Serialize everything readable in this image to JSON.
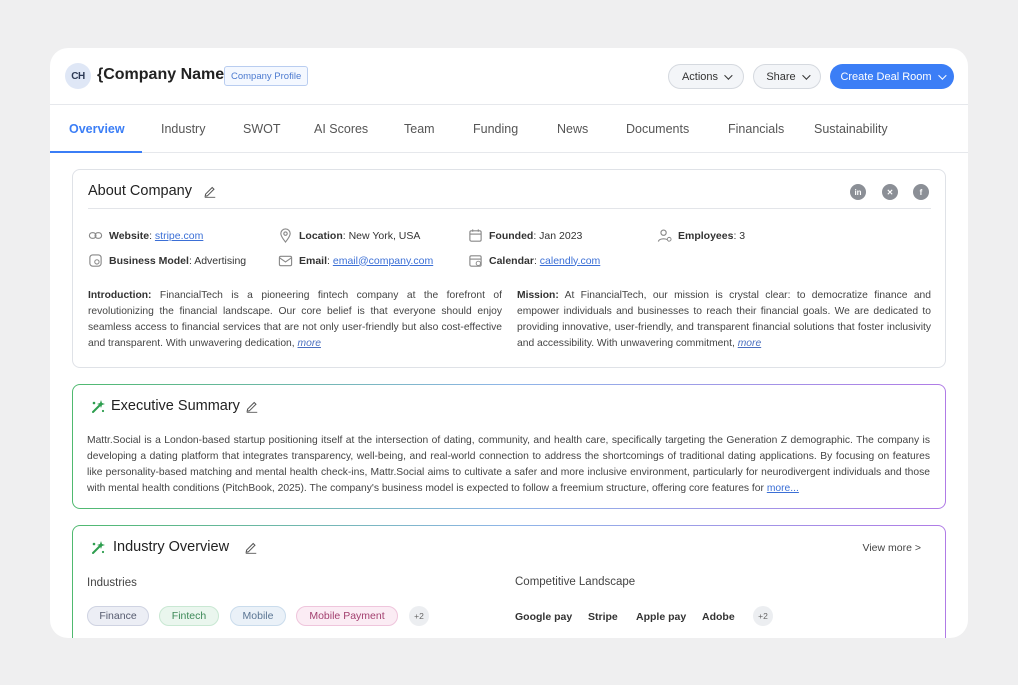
{
  "header": {
    "avatar_initials": "CH",
    "company_name": "{Company Name}",
    "badge": "Company Profile",
    "actions_label": "Actions",
    "share_label": "Share",
    "create_label": "Create Deal Room"
  },
  "tabs": [
    "Overview",
    "Industry",
    "SWOT",
    "AI Scores",
    "Team",
    "Funding",
    "News",
    "Documents",
    "Financials",
    "Sustainability"
  ],
  "about": {
    "title": "About Company",
    "website_label": "Website",
    "website_value": "stripe.com",
    "location_label": "Location",
    "location_value": "New York, USA",
    "founded_label": "Founded",
    "founded_value": "Jan 2023",
    "employees_label": "Employees",
    "employees_value": "3",
    "model_label": "Business Model",
    "model_value": "Advertising",
    "email_label": "Email",
    "email_value": "email@company.com",
    "calendar_label": "Calendar",
    "calendar_value": "calendly.com",
    "intro_label": "Introduction:",
    "intro_text": "FinancialTech is a pioneering fintech company at the forefront of revolutionizing the financial landscape. Our core belief is that everyone should enjoy seamless access to financial services that are not only user-friendly but also cost-effective and transparent. With unwavering dedication,",
    "mission_label": "Mission:",
    "mission_text": "At FinancialTech, our mission is crystal clear: to democratize finance and empower individuals and businesses to reach their financial goals. We are dedicated to providing innovative, user-friendly, and transparent financial solutions that foster inclusivity and accessibility. With unwavering commitment,",
    "more": "more"
  },
  "executive": {
    "title": "Executive Summary",
    "text": "Mattr.Social is a London-based startup positioning itself at the intersection of dating, community, and health care, specifically targeting the Generation Z demographic. The company is developing a dating platform that integrates transparency, well-being, and real-world connection to address the shortcomings of traditional dating applications. By focusing on features like personality-based matching and mental health check-ins, Mattr.Social aims to cultivate a safer and more inclusive environment, particularly for neurodivergent individuals and those with mental health conditions (PitchBook, 2025). The company's business model is expected to follow a freemium structure, offering core features for",
    "more": "more..."
  },
  "industry": {
    "title": "Industry Overview",
    "view_more": "View more >",
    "industries_heading": "Industries",
    "chips": [
      {
        "label": "Finance",
        "bg": "#eceef5",
        "border": "#cfd3e2",
        "color": "#555a6e"
      },
      {
        "label": "Fintech",
        "bg": "#eaf6ee",
        "border": "#c9e8d3",
        "color": "#3d8a58"
      },
      {
        "label": "Mobile",
        "bg": "#eaf1f8",
        "border": "#cadcec",
        "color": "#5a7593"
      },
      {
        "label": "Mobile Payment",
        "bg": "#fbecf4",
        "border": "#efc5dc",
        "color": "#a3406f"
      }
    ],
    "industries_more": "+2",
    "competitive_heading": "Competitive Landscape",
    "competitors": [
      "Google pay",
      "Stripe",
      "Apple pay",
      "Adobe"
    ],
    "competitors_more": "+2"
  },
  "colors": {
    "accent": "#3b7ef6",
    "spark_green": "#2e9e4f"
  }
}
